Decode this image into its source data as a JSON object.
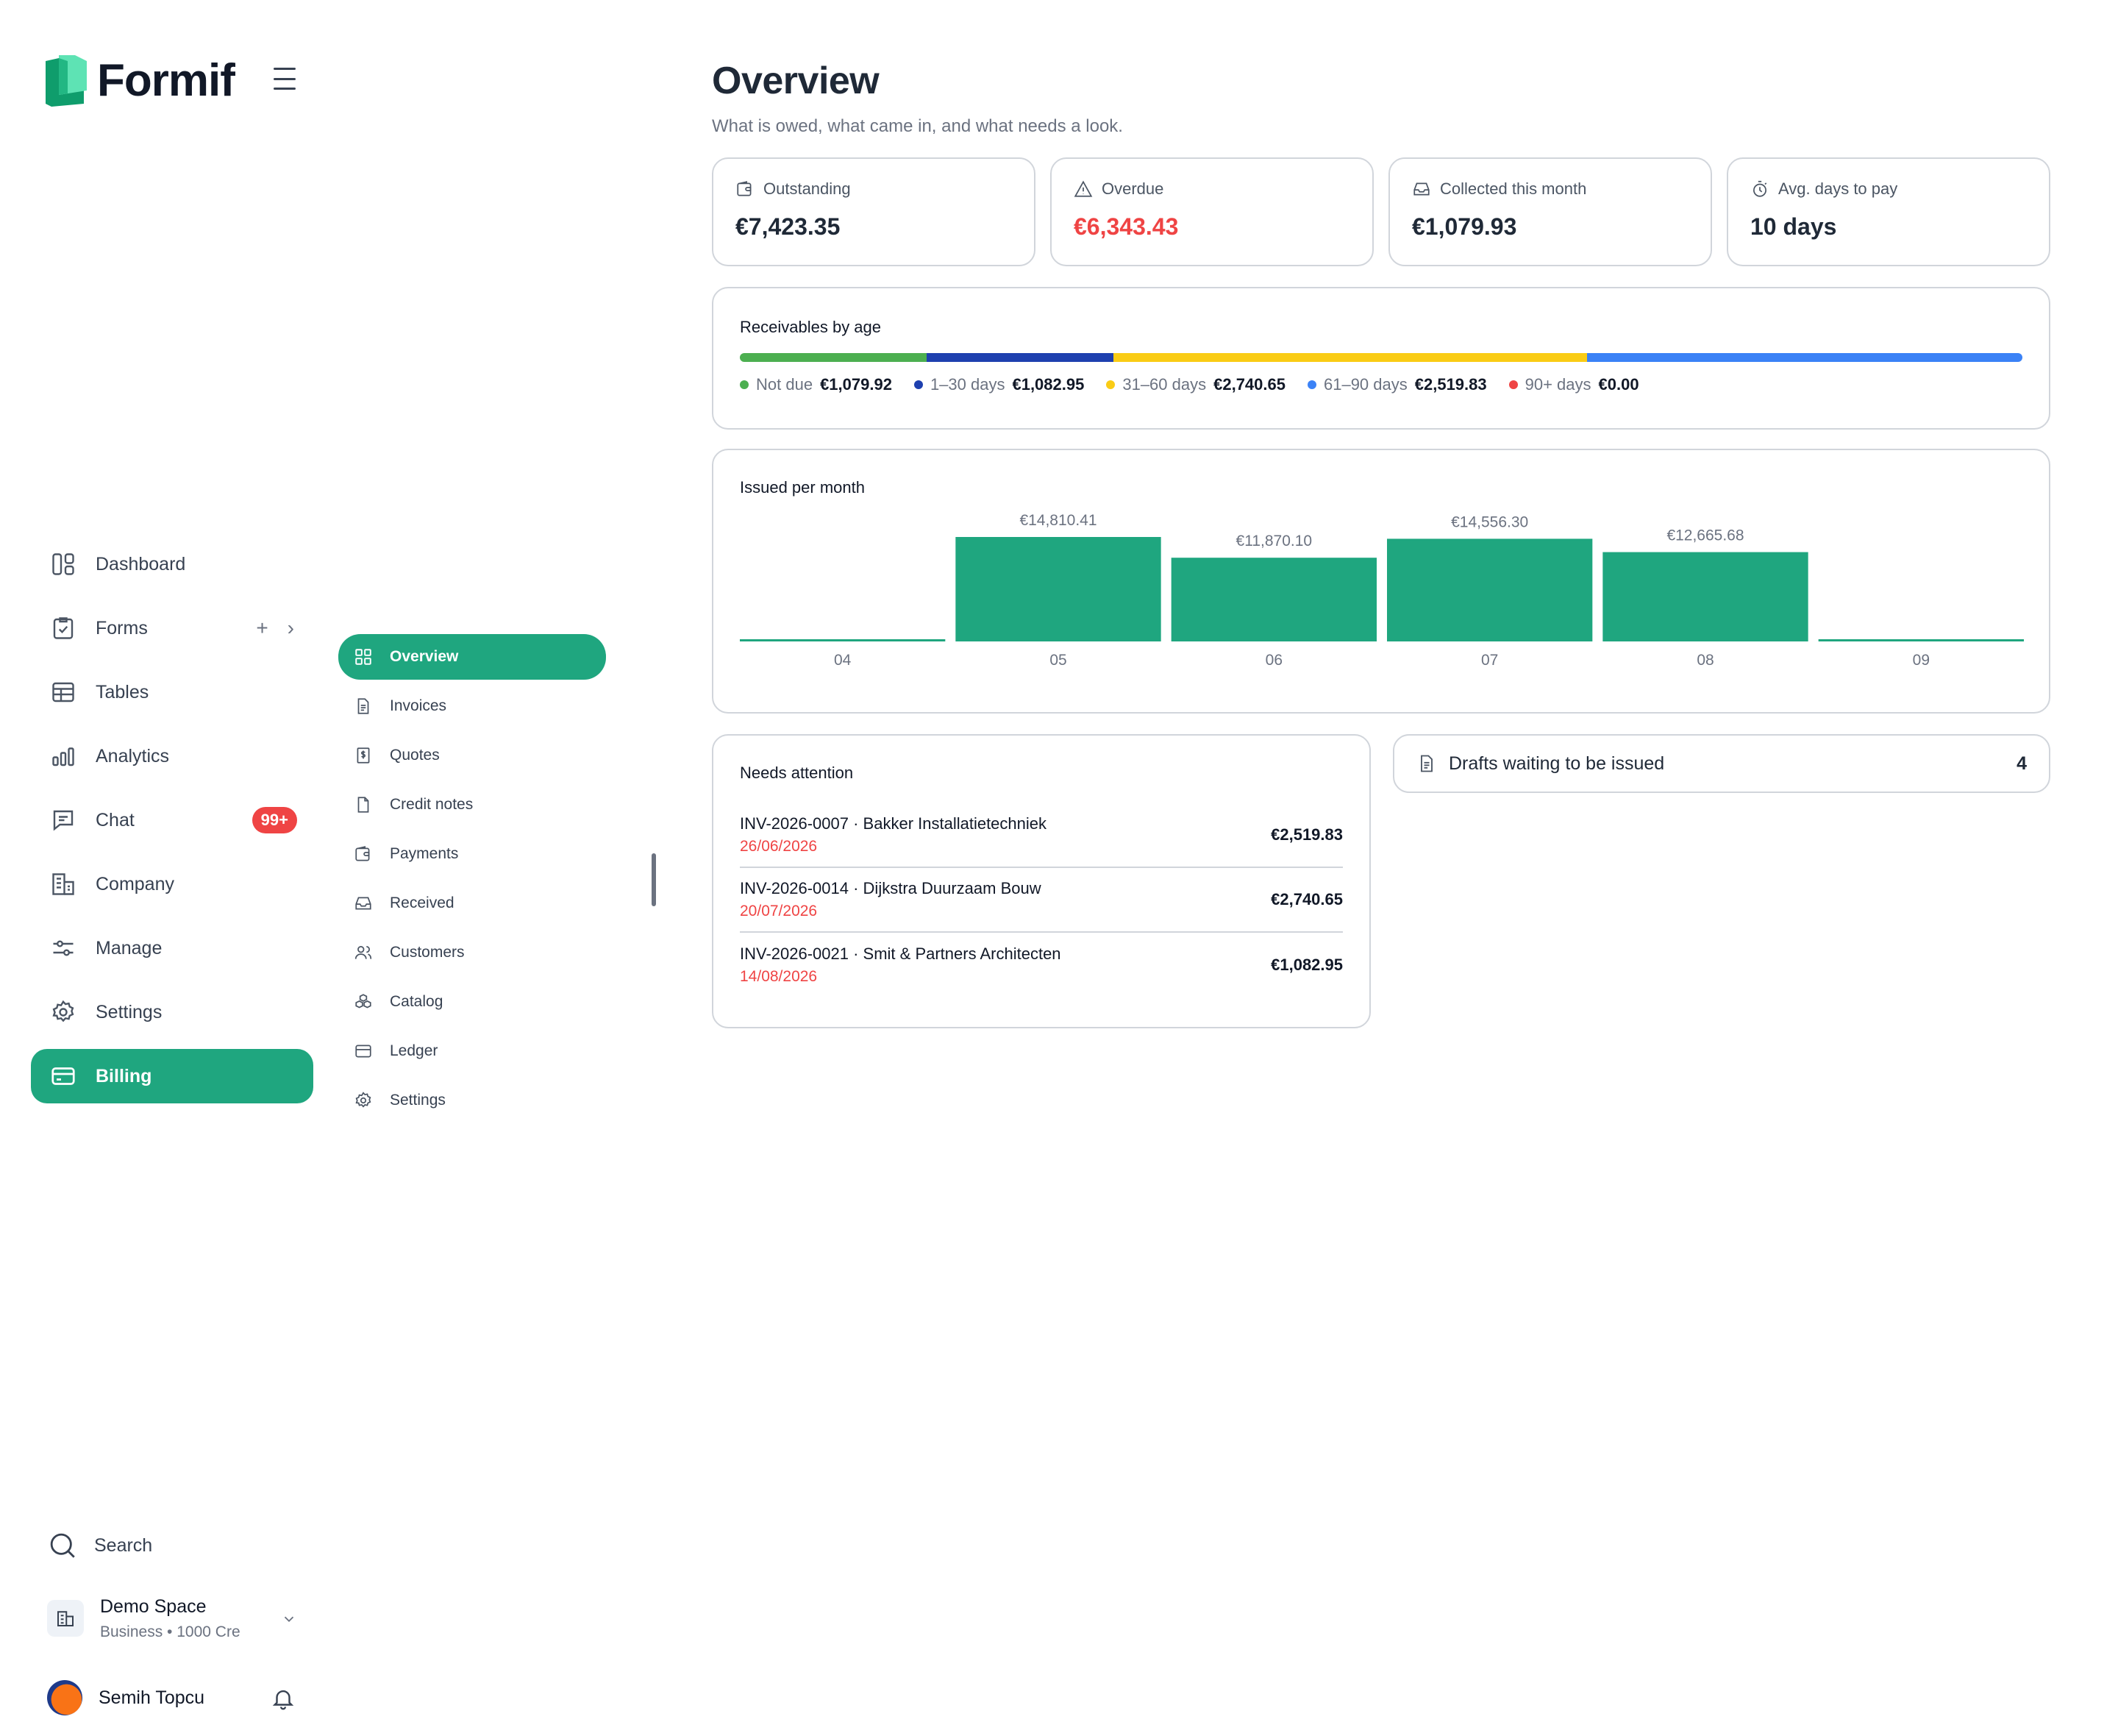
{
  "app": {
    "name": "Formif"
  },
  "nav": {
    "items": [
      {
        "label": "Dashboard",
        "icon": "dashboard-icon"
      },
      {
        "label": "Forms",
        "icon": "forms-icon"
      },
      {
        "label": "Tables",
        "icon": "tables-icon"
      },
      {
        "label": "Analytics",
        "icon": "analytics-icon"
      },
      {
        "label": "Chat",
        "icon": "chat-icon",
        "badge": "99+"
      },
      {
        "label": "Company",
        "icon": "company-icon"
      },
      {
        "label": "Manage",
        "icon": "sliders-icon"
      },
      {
        "label": "Settings",
        "icon": "gear-icon"
      },
      {
        "label": "Billing",
        "icon": "credit-card-icon",
        "active": true
      }
    ],
    "search_label": "Search",
    "workspace": {
      "name": "Demo Space",
      "plan": "Business",
      "credits": "1000 Cre"
    },
    "user": {
      "name": "Semih Topcu"
    }
  },
  "subnav": {
    "items": [
      {
        "label": "Overview",
        "active": true
      },
      {
        "label": "Invoices"
      },
      {
        "label": "Quotes"
      },
      {
        "label": "Credit notes"
      },
      {
        "label": "Payments"
      },
      {
        "label": "Received"
      },
      {
        "label": "Customers"
      },
      {
        "label": "Catalog"
      },
      {
        "label": "Ledger"
      },
      {
        "label": "Settings"
      }
    ]
  },
  "page": {
    "title": "Overview",
    "subtitle": "What is owed, what came in, and what needs a look."
  },
  "stats": [
    {
      "label": "Outstanding",
      "value": "€7,423.35",
      "icon": "wallet-icon"
    },
    {
      "label": "Overdue",
      "value": "€6,343.43",
      "icon": "warning-icon"
    },
    {
      "label": "Collected this month",
      "value": "€1,079.93",
      "icon": "inbox-icon"
    },
    {
      "label": "Avg. days to pay",
      "value": "10 days",
      "icon": "stopwatch-icon"
    }
  ],
  "receivables": {
    "title": "Receivables by age",
    "buckets": [
      {
        "label": "Not due",
        "amount": "€1,079.92",
        "value": 1079.92,
        "color": "#4caf50"
      },
      {
        "label": "1–30 days",
        "amount": "€1,082.95",
        "value": 1082.95,
        "color": "#1e40af"
      },
      {
        "label": "31–60 days",
        "amount": "€2,740.65",
        "value": 2740.65,
        "color": "#facc15"
      },
      {
        "label": "61–90 days",
        "amount": "€2,519.83",
        "value": 2519.83,
        "color": "#3b82f6"
      },
      {
        "label": "90+ days",
        "amount": "€0.00",
        "value": 0,
        "color": "#ef4444"
      }
    ]
  },
  "chart_data": {
    "type": "bar",
    "title": "Issued per month",
    "categories": [
      "04",
      "05",
      "06",
      "07",
      "08",
      "09"
    ],
    "values": [
      0,
      14810.41,
      11870.1,
      14556.3,
      12665.68,
      0
    ],
    "labels": [
      "",
      "€14,810.41",
      "€11,870.10",
      "€14,556.30",
      "€12,665.68",
      ""
    ],
    "color": "#1fa67f",
    "grid": false
  },
  "attention": {
    "title": "Needs attention",
    "rows": [
      {
        "title": "INV-2026-0007 · Bakker Installatietechniek",
        "date": "26/06/2026",
        "amount": "€2,519.83"
      },
      {
        "title": "INV-2026-0014 · Dijkstra Duurzaam Bouw",
        "date": "20/07/2026",
        "amount": "€2,740.65"
      },
      {
        "title": "INV-2026-0021 · Smit & Partners Architecten",
        "date": "14/08/2026",
        "amount": "€1,082.95"
      }
    ]
  },
  "drafts": {
    "label": "Drafts waiting to be issued",
    "count": "4"
  },
  "colors": {
    "accent": "#1fa67f",
    "danger": "#ef4444"
  }
}
